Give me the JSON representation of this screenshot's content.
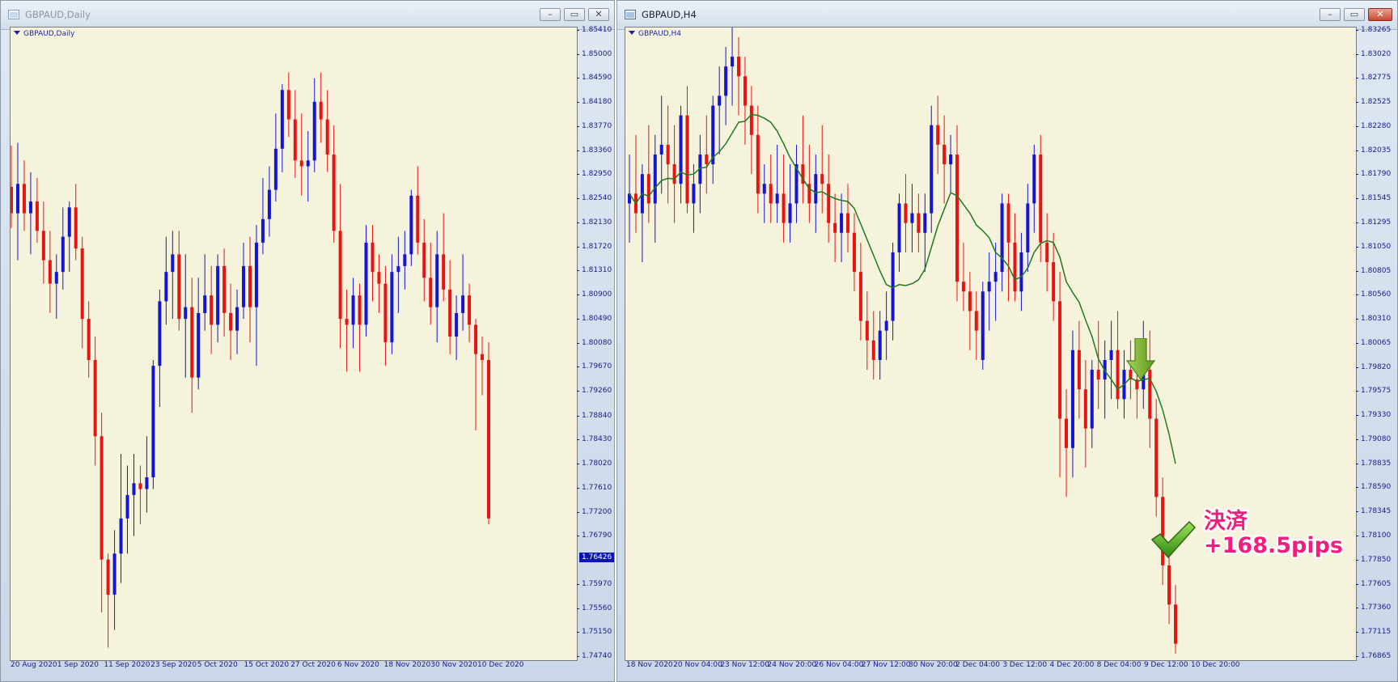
{
  "left_window": {
    "title": "GBPAUD,Daily",
    "chart_label": "GBPAUD,Daily",
    "current_price": "1.76426",
    "y_labels": [
      "1.85410",
      "1.85000",
      "1.84590",
      "1.84180",
      "1.83770",
      "1.83360",
      "1.82950",
      "1.82540",
      "1.82130",
      "1.81720",
      "1.81310",
      "1.80900",
      "1.80490",
      "1.80080",
      "1.79670",
      "1.79260",
      "1.78840",
      "1.78430",
      "1.78020",
      "1.77610",
      "1.77200",
      "1.76790",
      "1.75970",
      "1.75560",
      "1.75150",
      "1.74740"
    ],
    "x_labels": [
      "20 Aug 2020",
      "1 Sep 2020",
      "11 Sep 2020",
      "23 Sep 2020",
      "5 Oct 2020",
      "15 Oct 2020",
      "27 Oct 2020",
      "6 Nov 2020",
      "18 Nov 2020",
      "30 Nov 2020",
      "10 Dec 2020"
    ]
  },
  "right_window": {
    "title": "GBPAUD,H4",
    "chart_label": "GBPAUD,H4",
    "y_labels": [
      "1.83265",
      "1.83020",
      "1.82775",
      "1.82525",
      "1.82280",
      "1.82035",
      "1.81790",
      "1.81545",
      "1.81295",
      "1.81050",
      "1.80805",
      "1.80560",
      "1.80310",
      "1.80065",
      "1.79820",
      "1.79575",
      "1.79330",
      "1.79080",
      "1.78835",
      "1.78590",
      "1.78345",
      "1.78100",
      "1.77850",
      "1.77605",
      "1.77360",
      "1.77115",
      "1.76865"
    ],
    "x_labels": [
      "18 Nov 2020",
      "20 Nov 04:00",
      "23 Nov 12:00",
      "24 Nov 20:00",
      "26 Nov 04:00",
      "27 Nov 12:00",
      "30 Nov 20:00",
      "2 Dec 04:00",
      "3 Dec 12:00",
      "4 Dec 20:00",
      "8 Dec 04:00",
      "9 Dec 12:00",
      "10 Dec 20:00"
    ]
  },
  "annotation": {
    "line1": "決済",
    "line2": "+168.5pips"
  },
  "colors": {
    "bull": "#1414d2",
    "bear": "#e81414",
    "ma": "#1f7a1f",
    "chart_bg": "#f5f3dc",
    "axis_text": "#1a1a8c"
  },
  "chart_data": [
    {
      "type": "candlestick",
      "symbol": "GBPAUD",
      "timeframe": "Daily",
      "ylim": [
        1.7474,
        1.8541
      ],
      "last_price": 1.76426,
      "candles": [
        [
          1.8275,
          1.8345,
          1.8205,
          1.823
        ],
        [
          1.823,
          1.835,
          1.815,
          1.828
        ],
        [
          1.828,
          1.832,
          1.82,
          1.823
        ],
        [
          1.823,
          1.83,
          1.816,
          1.825
        ],
        [
          1.825,
          1.829,
          1.818,
          1.82
        ],
        [
          1.82,
          1.825,
          1.811,
          1.815
        ],
        [
          1.815,
          1.82,
          1.806,
          1.811
        ],
        [
          1.811,
          1.816,
          1.805,
          1.813
        ],
        [
          1.813,
          1.824,
          1.81,
          1.819
        ],
        [
          1.819,
          1.825,
          1.813,
          1.824
        ],
        [
          1.824,
          1.828,
          1.815,
          1.817
        ],
        [
          1.817,
          1.819,
          1.8,
          1.805
        ],
        [
          1.805,
          1.808,
          1.795,
          1.798
        ],
        [
          1.798,
          1.802,
          1.78,
          1.785
        ],
        [
          1.785,
          1.789,
          1.755,
          1.764
        ],
        [
          1.764,
          1.765,
          1.749,
          1.758
        ],
        [
          1.758,
          1.769,
          1.752,
          1.765
        ],
        [
          1.765,
          1.782,
          1.76,
          1.771
        ],
        [
          1.771,
          1.78,
          1.765,
          1.775
        ],
        [
          1.775,
          1.782,
          1.768,
          1.777
        ],
        [
          1.777,
          1.78,
          1.77,
          1.776
        ],
        [
          1.776,
          1.785,
          1.772,
          1.778
        ],
        [
          1.778,
          1.798,
          1.776,
          1.797
        ],
        [
          1.797,
          1.81,
          1.79,
          1.808
        ],
        [
          1.808,
          1.819,
          1.804,
          1.813
        ],
        [
          1.813,
          1.82,
          1.805,
          1.816
        ],
        [
          1.816,
          1.82,
          1.803,
          1.805
        ],
        [
          1.805,
          1.816,
          1.795,
          1.807
        ],
        [
          1.807,
          1.812,
          1.789,
          1.795
        ],
        [
          1.795,
          1.812,
          1.793,
          1.806
        ],
        [
          1.806,
          1.816,
          1.803,
          1.809
        ],
        [
          1.809,
          1.814,
          1.799,
          1.804
        ],
        [
          1.804,
          1.816,
          1.801,
          1.814
        ],
        [
          1.814,
          1.817,
          1.802,
          1.806
        ],
        [
          1.806,
          1.811,
          1.798,
          1.803
        ],
        [
          1.803,
          1.81,
          1.799,
          1.807
        ],
        [
          1.807,
          1.818,
          1.805,
          1.814
        ],
        [
          1.814,
          1.819,
          1.801,
          1.807
        ],
        [
          1.807,
          1.821,
          1.797,
          1.818
        ],
        [
          1.818,
          1.829,
          1.816,
          1.822
        ],
        [
          1.822,
          1.831,
          1.819,
          1.827
        ],
        [
          1.827,
          1.84,
          1.825,
          1.834
        ],
        [
          1.834,
          1.845,
          1.83,
          1.844
        ],
        [
          1.844,
          1.847,
          1.836,
          1.839
        ],
        [
          1.839,
          1.844,
          1.829,
          1.832
        ],
        [
          1.832,
          1.84,
          1.826,
          1.831
        ],
        [
          1.831,
          1.837,
          1.825,
          1.832
        ],
        [
          1.832,
          1.846,
          1.83,
          1.842
        ],
        [
          1.842,
          1.847,
          1.835,
          1.839
        ],
        [
          1.839,
          1.844,
          1.83,
          1.833
        ],
        [
          1.833,
          1.838,
          1.818,
          1.82
        ],
        [
          1.82,
          1.828,
          1.8,
          1.805
        ],
        [
          1.805,
          1.81,
          1.796,
          1.804
        ],
        [
          1.804,
          1.812,
          1.8,
          1.809
        ],
        [
          1.809,
          1.811,
          1.796,
          1.804
        ],
        [
          1.804,
          1.821,
          1.802,
          1.818
        ],
        [
          1.818,
          1.821,
          1.808,
          1.813
        ],
        [
          1.813,
          1.816,
          1.806,
          1.811
        ],
        [
          1.811,
          1.814,
          1.797,
          1.801
        ],
        [
          1.801,
          1.816,
          1.799,
          1.813
        ],
        [
          1.813,
          1.819,
          1.806,
          1.814
        ],
        [
          1.814,
          1.82,
          1.81,
          1.816
        ],
        [
          1.816,
          1.827,
          1.814,
          1.826
        ],
        [
          1.826,
          1.831,
          1.816,
          1.818
        ],
        [
          1.818,
          1.822,
          1.808,
          1.812
        ],
        [
          1.812,
          1.818,
          1.804,
          1.807
        ],
        [
          1.807,
          1.82,
          1.801,
          1.816
        ],
        [
          1.816,
          1.823,
          1.808,
          1.81
        ],
        [
          1.81,
          1.815,
          1.799,
          1.802
        ],
        [
          1.802,
          1.809,
          1.798,
          1.806
        ],
        [
          1.806,
          1.816,
          1.803,
          1.809
        ],
        [
          1.809,
          1.811,
          1.801,
          1.804
        ],
        [
          1.804,
          1.805,
          1.786,
          1.799
        ],
        [
          1.799,
          1.802,
          1.792,
          1.798
        ],
        [
          1.798,
          1.801,
          1.77,
          1.771
        ]
      ]
    },
    {
      "type": "candlestick",
      "symbol": "GBPAUD",
      "timeframe": "H4",
      "ylim": [
        1.76865,
        1.83265
      ],
      "indicator": "moving average",
      "candles": [
        [
          1.815,
          1.82,
          1.811,
          1.816
        ],
        [
          1.816,
          1.822,
          1.812,
          1.814
        ],
        [
          1.814,
          1.819,
          1.809,
          1.818
        ],
        [
          1.818,
          1.823,
          1.813,
          1.815
        ],
        [
          1.815,
          1.822,
          1.811,
          1.82
        ],
        [
          1.82,
          1.826,
          1.816,
          1.821
        ],
        [
          1.821,
          1.825,
          1.815,
          1.819
        ],
        [
          1.819,
          1.823,
          1.813,
          1.817
        ],
        [
          1.817,
          1.825,
          1.815,
          1.824
        ],
        [
          1.824,
          1.827,
          1.814,
          1.815
        ],
        [
          1.815,
          1.819,
          1.812,
          1.817
        ],
        [
          1.817,
          1.822,
          1.814,
          1.82
        ],
        [
          1.82,
          1.824,
          1.816,
          1.819
        ],
        [
          1.819,
          1.826,
          1.817,
          1.825
        ],
        [
          1.825,
          1.829,
          1.82,
          1.826
        ],
        [
          1.826,
          1.831,
          1.823,
          1.829
        ],
        [
          1.829,
          1.833,
          1.825,
          1.83
        ],
        [
          1.83,
          1.832,
          1.824,
          1.828
        ],
        [
          1.828,
          1.83,
          1.821,
          1.825
        ],
        [
          1.825,
          1.827,
          1.818,
          1.822
        ],
        [
          1.822,
          1.825,
          1.814,
          1.816
        ],
        [
          1.816,
          1.819,
          1.813,
          1.817
        ],
        [
          1.817,
          1.82,
          1.813,
          1.815
        ],
        [
          1.815,
          1.821,
          1.813,
          1.816
        ],
        [
          1.816,
          1.82,
          1.811,
          1.813
        ],
        [
          1.813,
          1.819,
          1.811,
          1.815
        ],
        [
          1.815,
          1.821,
          1.813,
          1.819
        ],
        [
          1.819,
          1.824,
          1.815,
          1.817
        ],
        [
          1.817,
          1.821,
          1.813,
          1.815
        ],
        [
          1.815,
          1.82,
          1.812,
          1.818
        ],
        [
          1.818,
          1.823,
          1.814,
          1.817
        ],
        [
          1.817,
          1.82,
          1.811,
          1.813
        ],
        [
          1.813,
          1.816,
          1.809,
          1.812
        ],
        [
          1.812,
          1.816,
          1.809,
          1.814
        ],
        [
          1.814,
          1.817,
          1.81,
          1.812
        ],
        [
          1.812,
          1.814,
          1.806,
          1.808
        ],
        [
          1.808,
          1.811,
          1.801,
          1.803
        ],
        [
          1.803,
          1.806,
          1.798,
          1.801
        ],
        [
          1.801,
          1.804,
          1.797,
          1.799
        ],
        [
          1.799,
          1.804,
          1.797,
          1.802
        ],
        [
          1.802,
          1.806,
          1.799,
          1.803
        ],
        [
          1.803,
          1.811,
          1.801,
          1.81
        ],
        [
          1.81,
          1.816,
          1.808,
          1.815
        ],
        [
          1.815,
          1.818,
          1.81,
          1.813
        ],
        [
          1.813,
          1.817,
          1.81,
          1.814
        ],
        [
          1.814,
          1.816,
          1.81,
          1.812
        ],
        [
          1.812,
          1.816,
          1.808,
          1.814
        ],
        [
          1.814,
          1.825,
          1.812,
          1.823
        ],
        [
          1.823,
          1.826,
          1.818,
          1.821
        ],
        [
          1.821,
          1.824,
          1.815,
          1.819
        ],
        [
          1.819,
          1.822,
          1.816,
          1.82
        ],
        [
          1.82,
          1.823,
          1.805,
          1.807
        ],
        [
          1.807,
          1.811,
          1.804,
          1.806
        ],
        [
          1.806,
          1.808,
          1.8,
          1.804
        ],
        [
          1.804,
          1.806,
          1.799,
          1.802
        ],
        [
          1.799,
          1.807,
          1.798,
          1.806
        ],
        [
          1.806,
          1.81,
          1.802,
          1.807
        ],
        [
          1.807,
          1.811,
          1.803,
          1.808
        ],
        [
          1.808,
          1.816,
          1.806,
          1.815
        ],
        [
          1.815,
          1.816,
          1.805,
          1.811
        ],
        [
          1.811,
          1.814,
          1.805,
          1.806
        ],
        [
          1.806,
          1.812,
          1.804,
          1.81
        ],
        [
          1.81,
          1.817,
          1.808,
          1.815
        ],
        [
          1.815,
          1.821,
          1.812,
          1.82
        ],
        [
          1.82,
          1.822,
          1.809,
          1.811
        ],
        [
          1.811,
          1.814,
          1.806,
          1.809
        ],
        [
          1.809,
          1.812,
          1.803,
          1.805
        ],
        [
          1.805,
          1.808,
          1.787,
          1.793
        ],
        [
          1.793,
          1.796,
          1.785,
          1.79
        ],
        [
          1.79,
          1.802,
          1.787,
          1.8
        ],
        [
          1.8,
          1.803,
          1.793,
          1.796
        ],
        [
          1.796,
          1.799,
          1.788,
          1.792
        ],
        [
          1.792,
          1.799,
          1.79,
          1.798
        ],
        [
          1.798,
          1.803,
          1.794,
          1.797
        ],
        [
          1.797,
          1.801,
          1.793,
          1.799
        ],
        [
          1.799,
          1.803,
          1.795,
          1.8
        ],
        [
          1.8,
          1.804,
          1.794,
          1.795
        ],
        [
          1.795,
          1.8,
          1.793,
          1.798
        ],
        [
          1.798,
          1.801,
          1.795,
          1.797
        ],
        [
          1.797,
          1.8,
          1.793,
          1.796
        ],
        [
          1.796,
          1.803,
          1.794,
          1.798
        ],
        [
          1.798,
          1.802,
          1.79,
          1.793
        ],
        [
          1.793,
          1.795,
          1.783,
          1.785
        ],
        [
          1.785,
          1.787,
          1.776,
          1.778
        ],
        [
          1.778,
          1.78,
          1.772,
          1.774
        ],
        [
          1.774,
          1.776,
          1.769,
          1.77
        ]
      ]
    }
  ]
}
